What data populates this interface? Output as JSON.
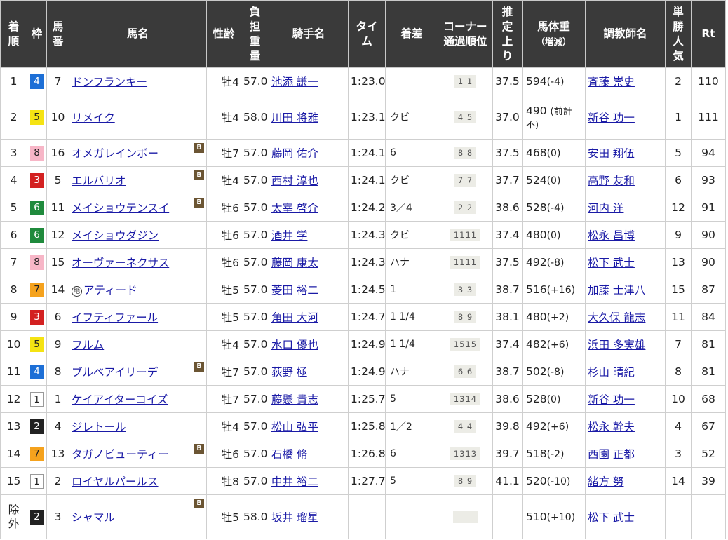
{
  "headers": {
    "rank": [
      "着",
      "順"
    ],
    "waku": "枠",
    "num": [
      "馬",
      "番"
    ],
    "name": "馬名",
    "sex_age": "性齢",
    "weight": [
      "負",
      "担",
      "重",
      "量"
    ],
    "jockey": "騎手名",
    "time": [
      "タイ",
      "ム"
    ],
    "margin": "着差",
    "corner": [
      "コーナー",
      "通過順位"
    ],
    "agari": [
      "推",
      "定",
      "上",
      "り"
    ],
    "body_weight": [
      "馬体重",
      "（増減）"
    ],
    "trainer": "調教師名",
    "popularity": [
      "単",
      "勝",
      "人",
      "気"
    ],
    "rt": "Rt"
  },
  "blinker_label": "B",
  "local_label": "地",
  "excluded_rank": [
    "除",
    "外"
  ],
  "rows": [
    {
      "rank": "1",
      "waku": "4",
      "num": "7",
      "name": "ドンフランキー",
      "blinker": false,
      "local": false,
      "sex": "牡4",
      "weight": "57.0",
      "jockey": "池添 謙一",
      "time": "1:23.0",
      "margin": "",
      "corner": "1 1",
      "agari": "37.5",
      "bw": "594",
      "diff": "(-4)",
      "trainer": "斉藤 崇史",
      "pop": "2",
      "rt": "110"
    },
    {
      "rank": "2",
      "waku": "5",
      "num": "10",
      "name": "リメイク",
      "blinker": false,
      "local": false,
      "sex": "牡4",
      "weight": "58.0",
      "jockey": "川田 将雅",
      "time": "1:23.1",
      "margin": "クビ",
      "corner": "4 5",
      "agari": "37.0",
      "bw": "490",
      "diff": "",
      "bw_note_1": "(前計",
      "bw_note_2": "不)",
      "trainer": "新谷 功一",
      "pop": "1",
      "rt": "111"
    },
    {
      "rank": "3",
      "waku": "8",
      "num": "16",
      "name": "オメガレインボー",
      "blinker": true,
      "local": false,
      "sex": "牡7",
      "weight": "57.0",
      "jockey": "藤岡 佑介",
      "time": "1:24.1",
      "margin": "6",
      "corner": "8 8",
      "agari": "37.5",
      "bw": "468",
      "diff": "(0)",
      "trainer": "安田 翔伍",
      "pop": "5",
      "rt": "94"
    },
    {
      "rank": "4",
      "waku": "3",
      "num": "5",
      "name": "エルバリオ",
      "blinker": true,
      "local": false,
      "sex": "牡4",
      "weight": "57.0",
      "jockey": "西村 淳也",
      "time": "1:24.1",
      "margin": "クビ",
      "corner": "7 7",
      "agari": "37.7",
      "bw": "524",
      "diff": "(0)",
      "trainer": "高野 友和",
      "pop": "6",
      "rt": "93"
    },
    {
      "rank": "5",
      "waku": "6",
      "num": "11",
      "name": "メイショウテンスイ",
      "blinker": true,
      "local": false,
      "sex": "牡6",
      "weight": "57.0",
      "jockey": "太宰 啓介",
      "time": "1:24.2",
      "margin": "3／4",
      "corner": "2 2",
      "agari": "38.6",
      "bw": "528",
      "diff": "(-4)",
      "trainer": "河内 洋",
      "pop": "12",
      "rt": "91"
    },
    {
      "rank": "6",
      "waku": "6",
      "num": "12",
      "name": "メイショウダジン",
      "blinker": false,
      "local": false,
      "sex": "牡6",
      "weight": "57.0",
      "jockey": "酒井 学",
      "time": "1:24.3",
      "margin": "クビ",
      "corner": "1111",
      "agari": "37.4",
      "bw": "480",
      "diff": "(0)",
      "trainer": "松永 昌博",
      "pop": "9",
      "rt": "90"
    },
    {
      "rank": "7",
      "waku": "8",
      "num": "15",
      "name": "オーヴァーネクサス",
      "blinker": false,
      "local": false,
      "sex": "牡6",
      "weight": "57.0",
      "jockey": "藤岡 康太",
      "time": "1:24.3",
      "margin": "ハナ",
      "corner": "1111",
      "agari": "37.5",
      "bw": "492",
      "diff": "(-8)",
      "trainer": "松下 武士",
      "pop": "13",
      "rt": "90"
    },
    {
      "rank": "8",
      "waku": "7",
      "num": "14",
      "name": "アティード",
      "blinker": false,
      "local": true,
      "sex": "牡5",
      "weight": "57.0",
      "jockey": "菱田 裕二",
      "time": "1:24.5",
      "margin": "1",
      "corner": "3 3",
      "agari": "38.7",
      "bw": "516",
      "diff": "(+16)",
      "trainer": "加藤 士津八",
      "pop": "15",
      "rt": "87"
    },
    {
      "rank": "9",
      "waku": "3",
      "num": "6",
      "name": "イフティファール",
      "blinker": false,
      "local": false,
      "sex": "牡5",
      "weight": "57.0",
      "jockey": "角田 大河",
      "time": "1:24.7",
      "margin": "1 1/4",
      "corner": "8 9",
      "agari": "38.1",
      "bw": "480",
      "diff": "(+2)",
      "trainer": "大久保 龍志",
      "pop": "11",
      "rt": "84"
    },
    {
      "rank": "10",
      "waku": "5",
      "num": "9",
      "name": "フルム",
      "blinker": false,
      "local": false,
      "sex": "牡4",
      "weight": "57.0",
      "jockey": "水口 優也",
      "time": "1:24.9",
      "margin": "1 1/4",
      "corner": "1515",
      "agari": "37.4",
      "bw": "482",
      "diff": "(+6)",
      "trainer": "浜田 多実雄",
      "pop": "7",
      "rt": "81"
    },
    {
      "rank": "11",
      "waku": "4",
      "num": "8",
      "name": "ブルベアイリーデ",
      "blinker": true,
      "local": false,
      "sex": "牡7",
      "weight": "57.0",
      "jockey": "荻野 極",
      "time": "1:24.9",
      "margin": "ハナ",
      "corner": "6 6",
      "agari": "38.7",
      "bw": "502",
      "diff": "(-8)",
      "trainer": "杉山 晴紀",
      "pop": "8",
      "rt": "81"
    },
    {
      "rank": "12",
      "waku": "1",
      "num": "1",
      "name": "ケイアイターコイズ",
      "blinker": false,
      "local": false,
      "sex": "牡7",
      "weight": "57.0",
      "jockey": "藤懸 貴志",
      "time": "1:25.7",
      "margin": "5",
      "corner": "1314",
      "agari": "38.6",
      "bw": "528",
      "diff": "(0)",
      "trainer": "新谷 功一",
      "pop": "10",
      "rt": "68"
    },
    {
      "rank": "13",
      "waku": "2",
      "num": "4",
      "name": "ジレトール",
      "blinker": false,
      "local": false,
      "sex": "牡4",
      "weight": "57.0",
      "jockey": "松山 弘平",
      "time": "1:25.8",
      "margin": "1／2",
      "corner": "4 4",
      "agari": "39.8",
      "bw": "492",
      "diff": "(+6)",
      "trainer": "松永 幹夫",
      "pop": "4",
      "rt": "67"
    },
    {
      "rank": "14",
      "waku": "7",
      "num": "13",
      "name": "タガノビューティー",
      "blinker": true,
      "local": false,
      "sex": "牡6",
      "weight": "57.0",
      "jockey": "石橋 脩",
      "time": "1:26.8",
      "margin": "6",
      "corner": "1313",
      "agari": "39.7",
      "bw": "518",
      "diff": "(-2)",
      "trainer": "西園 正都",
      "pop": "3",
      "rt": "52"
    },
    {
      "rank": "15",
      "waku": "1",
      "num": "2",
      "name": "ロイヤルパールス",
      "blinker": false,
      "local": false,
      "sex": "牡8",
      "weight": "57.0",
      "jockey": "中井 裕二",
      "time": "1:27.7",
      "margin": "5",
      "corner": "8 9",
      "agari": "41.1",
      "bw": "520",
      "diff": "(-10)",
      "trainer": "緒方 努",
      "pop": "14",
      "rt": "39"
    },
    {
      "rank": "除外",
      "waku": "2",
      "num": "3",
      "name": "シャマル",
      "blinker": true,
      "local": false,
      "sex": "牡5",
      "weight": "58.0",
      "jockey": "坂井 瑠星",
      "time": "",
      "margin": "",
      "corner": "",
      "agari": "",
      "bw": "510",
      "diff": "(+10)",
      "trainer": "松下 武士",
      "pop": "",
      "rt": ""
    }
  ],
  "colors": {
    "header_bg": "#3a3a3a",
    "link": "#1a1aa6",
    "waku_1": "#ffffff",
    "waku_2": "#222222",
    "waku_3": "#d32121",
    "waku_4": "#1d6fd6",
    "waku_5": "#f5e313",
    "waku_6": "#1f8a3c",
    "waku_7": "#f5a21d",
    "waku_8": "#f7b6c7",
    "blinker": "#6b5533"
  }
}
